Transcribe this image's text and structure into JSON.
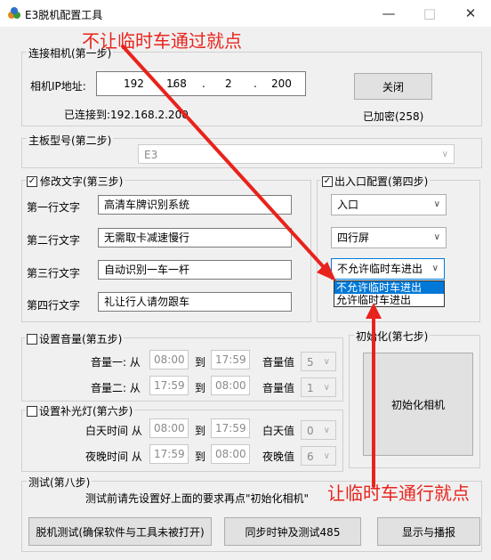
{
  "window": {
    "title": "E3脱机配置工具",
    "minimize": "—",
    "maximize": "□",
    "close": "✕"
  },
  "annotations": {
    "top_note": "不让临时车通过就点",
    "bottom_note": "让临时车通行就点",
    "arrow_color": "#e8231c"
  },
  "step1": {
    "group_label": "连接相机(第一步)",
    "ip_label": "相机IP地址:",
    "ip": [
      "192",
      "168",
      "2",
      "200"
    ],
    "ip_dot": ".",
    "close_button": "关闭",
    "connected_text": "已连接到:192.168.2.200",
    "encrypted_text": "已加密(258)"
  },
  "step2": {
    "group_label": "主板型号(第二步)",
    "board_value": "E3"
  },
  "step3": {
    "group_label": "修改文字(第三步)",
    "checked": true,
    "rows": [
      {
        "label": "第一行文字",
        "value": "高清车牌识别系统"
      },
      {
        "label": "第二行文字",
        "value": "无需取卡减速慢行"
      },
      {
        "label": "第三行文字",
        "value": "自动识别一车一杆"
      },
      {
        "label": "第四行文字",
        "value": "礼让行人请勿跟车"
      }
    ]
  },
  "step4": {
    "group_label": "出入口配置(第四步)",
    "checked": true,
    "direction": "入口",
    "screen": "四行屏",
    "temp_car_selected": "不允许临时车进出",
    "temp_car_options": [
      "不允许临时车进出",
      "允许临时车进出"
    ]
  },
  "step5": {
    "group_label": "设置音量(第五步)",
    "checked": false,
    "rows": [
      {
        "label": "音量一: 从",
        "from": "08:00",
        "to_label": "到",
        "to": "17:59",
        "vol_label": "音量值",
        "vol": "5"
      },
      {
        "label": "音量二: 从",
        "from": "17:59",
        "to_label": "到",
        "to": "08:00",
        "vol_label": "音量值",
        "vol": "1"
      }
    ]
  },
  "step6": {
    "group_label": "设置补光灯(第六步)",
    "checked": false,
    "rows": [
      {
        "label": "白天时间 从",
        "from": "08:00",
        "to_label": "到",
        "to": "17:59",
        "val_label": "白天值",
        "val": "0"
      },
      {
        "label": "夜晚时间 从",
        "from": "17:59",
        "to_label": "到",
        "to": "08:00",
        "val_label": "夜晚值",
        "val": "6"
      }
    ]
  },
  "step7": {
    "group_label": "初始化(第七步)",
    "init_button": "初始化相机"
  },
  "step8": {
    "group_label": "测试(第八步)",
    "hint": "测试前请先设置好上面的要求再点\"初始化相机\"",
    "buttons": [
      "脱机测试(确保软件与工具未被打开)",
      "同步时钟及测试485",
      "显示与播报"
    ]
  }
}
